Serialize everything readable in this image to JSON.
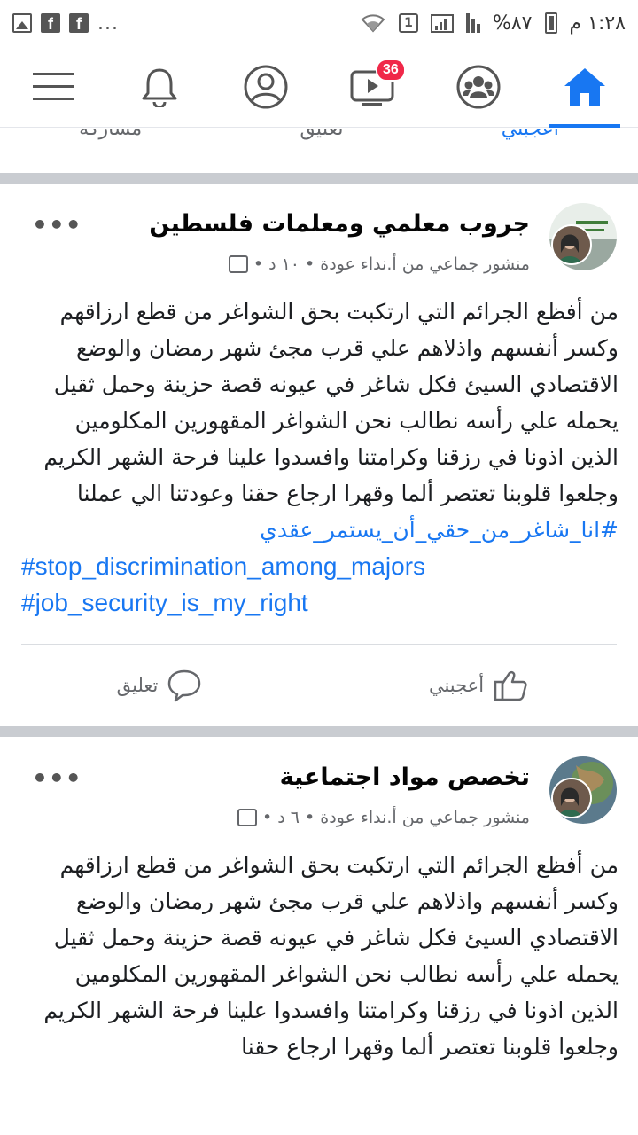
{
  "status_bar": {
    "time": "١:٢٨ م",
    "battery_percent": "%٨٧",
    "notification_badge": "1",
    "overflow": "..."
  },
  "nav": {
    "items": [
      {
        "name": "menu",
        "icon": "menu-icon"
      },
      {
        "name": "notifications",
        "icon": "bell-icon"
      },
      {
        "name": "profile",
        "icon": "profile-icon"
      },
      {
        "name": "watch",
        "icon": "video-icon",
        "badge": "36"
      },
      {
        "name": "groups",
        "icon": "groups-icon"
      },
      {
        "name": "home",
        "icon": "home-icon",
        "active": true
      }
    ],
    "accent": "#1877f2",
    "badge_color": "#f02849"
  },
  "partial_post": {
    "like_label": "أعجبني",
    "comment_label": "تعليق",
    "share_label": "مشاركة"
  },
  "posts": [
    {
      "title": "جروب معلمي ومعلمات فلسطين",
      "meta": "منشور جماعي من أ.نداء عودة • ١٠ د •",
      "body": "من أفظع الجرائم التي ارتكبت بحق الشواغر من قطع ارزاقهم وكسر أنفسهم واذلاهم علي قرب مجئ شهر رمضان والوضع الاقتصادي السيئ فكل شاغر في عيونه  قصة حزينة وحمل ثقيل يحمله علي رأسه نطالب نحن الشواغر المقهورين المكلومين الذين اذونا في رزقنا وكرامتنا وافسدوا علينا فرحة الشهر الكريم وجلعوا قلوبنا تعتصر ألما وقهرا ارجاع حقنا وعودتنا الي عملنا",
      "hashtags_rtl": [
        "#انا_شاغر_من_حقي_أن_يستمر_عقدي"
      ],
      "hashtags_ltr": [
        "#stop_discrimination_among_majors",
        "#job_security_is_my_right"
      ],
      "like_label": "أعجبني",
      "comment_label": "تعليق"
    },
    {
      "title": "تخصص مواد اجتماعية",
      "meta": "منشور جماعي من أ.نداء عودة • ٦ د •",
      "body": "من أفظع الجرائم التي ارتكبت بحق الشواغر من قطع ارزاقهم وكسر أنفسهم واذلاهم علي قرب مجئ شهر رمضان والوضع الاقتصادي السيئ فكل شاغر في عيونه  قصة حزينة وحمل ثقيل يحمله علي رأسه نطالب نحن الشواغر المقهورين المكلومين الذين اذونا في رزقنا وكرامتنا وافسدوا علينا فرحة الشهر الكريم وجلعوا قلوبنا تعتصر ألما وقهرا ارجاع حقنا"
    }
  ]
}
